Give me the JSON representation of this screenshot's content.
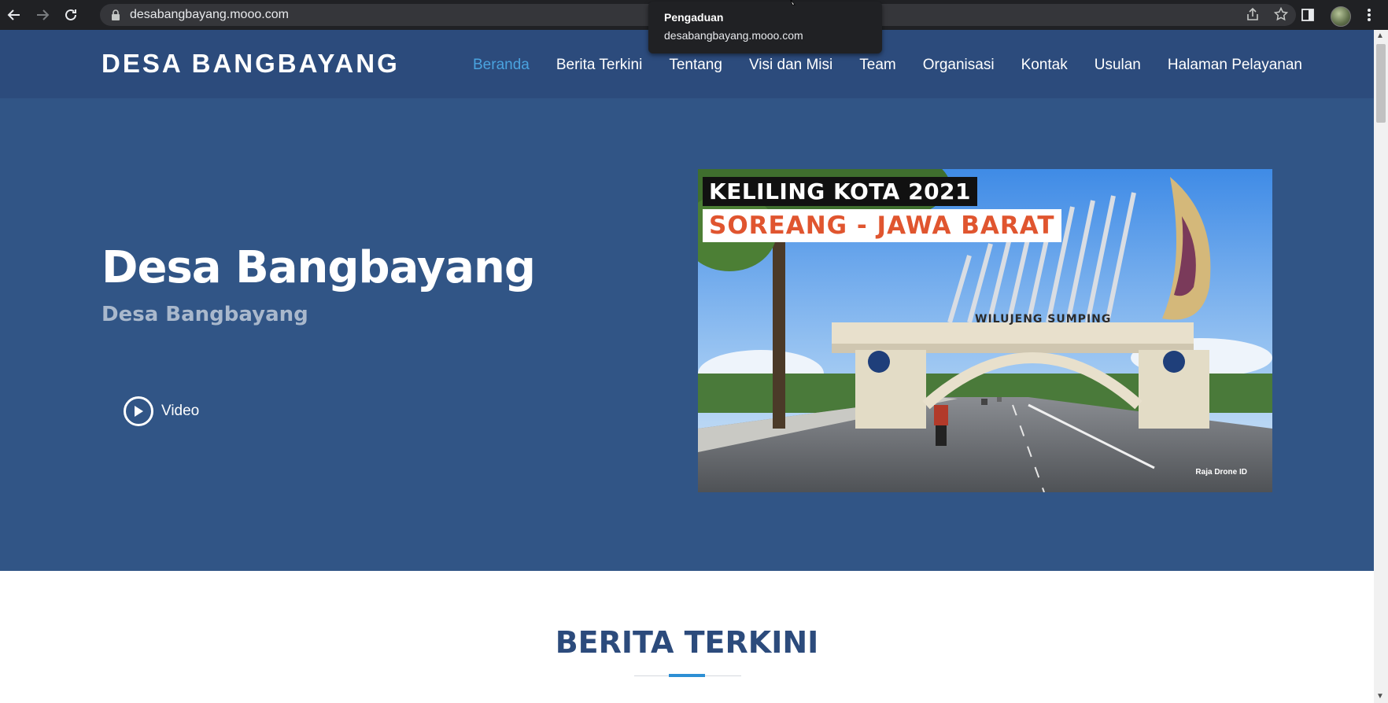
{
  "browser": {
    "url": "desabangbayang.mooo.com",
    "tooltip_title": "Pengaduan",
    "tooltip_url": "desabangbayang.mooo.com"
  },
  "site": {
    "logo": "DESA BANGBAYANG",
    "menu": [
      {
        "label": "Beranda",
        "active": true
      },
      {
        "label": "Berita Terkini"
      },
      {
        "label": "Tentang"
      },
      {
        "label": "Visi dan Misi"
      },
      {
        "label": "Team"
      },
      {
        "label": "Organisasi"
      },
      {
        "label": "Kontak"
      },
      {
        "label": "Usulan"
      },
      {
        "label": "Halaman Pelayanan"
      }
    ]
  },
  "hero": {
    "title": "Desa Bangbayang",
    "subtitle": "Desa Bangbayang",
    "video_label": "Video",
    "thumbnail": {
      "line1": "KELILING KOTA 2021",
      "line2": "SOREANG - JAWA BARAT",
      "arch_text": "WILUJENG SUMPING",
      "watermark": "Raja Drone ID"
    }
  },
  "section": {
    "title": "BERITA TERKINI"
  },
  "colors": {
    "header_bg": "#2c4b7c",
    "hero_bg": "#315586",
    "active_link": "#4aa3df",
    "accent": "#2d8fd4"
  }
}
